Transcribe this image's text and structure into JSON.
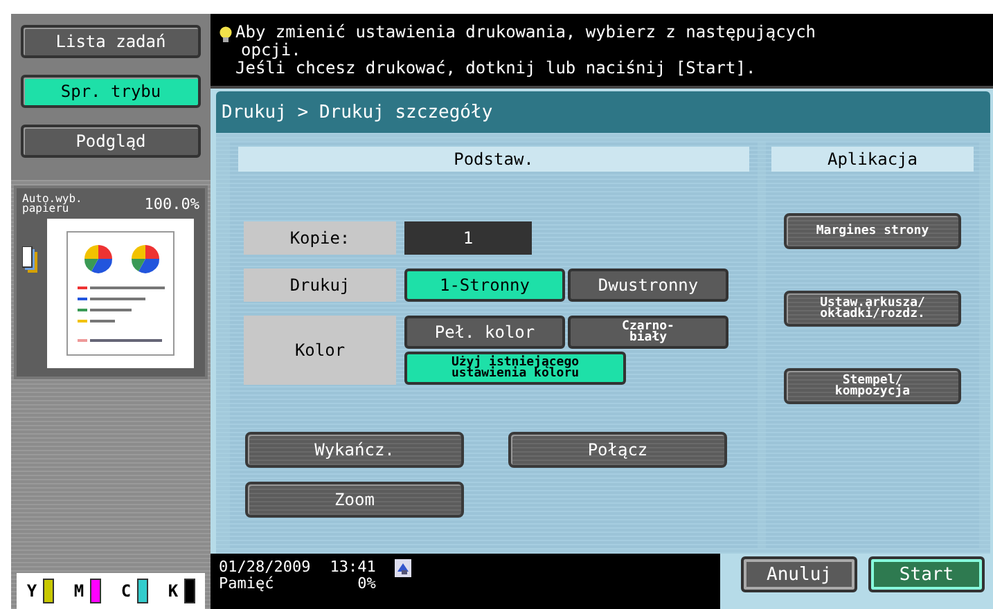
{
  "sidebar": {
    "buttons": [
      {
        "label": "Lista zadań",
        "selected": false
      },
      {
        "label": "Spr. trybu",
        "selected": true
      },
      {
        "label": "Podgląd",
        "selected": false
      }
    ],
    "preview": {
      "paper": "Auto.wyb.\npapieru",
      "zoom": "100.0%"
    },
    "toner": [
      {
        "label": "Y",
        "color": "#c8c800"
      },
      {
        "label": "M",
        "color": "#ff00ff"
      },
      {
        "label": "C",
        "color": "#33cccc"
      },
      {
        "label": "K",
        "color": "#000000"
      }
    ]
  },
  "message": {
    "lines": [
      "Aby zmienić ustawienia drukowania, wybierz z następujących",
      "opcji.",
      "Jeśli chcesz drukować, dotknij lub naciśnij [Start]."
    ]
  },
  "breadcrumb": "Drukuj > Drukuj szczegóły",
  "basic": {
    "title": "Podstaw.",
    "copies": {
      "label": "Kopie:",
      "value": "1"
    },
    "settings": [
      {
        "label": "Drukuj",
        "options": [
          {
            "label": "1-Stronny",
            "selected": true
          },
          {
            "label": "Dwustronny",
            "selected": false
          }
        ]
      },
      {
        "label": "Kolor",
        "options": [
          {
            "label": "Peł. kolor",
            "selected": false
          },
          {
            "label": "Czarno-\nbiały",
            "selected": false
          },
          {
            "label": "Użyj istniejącego\nustawienia koloru",
            "selected": true
          }
        ]
      }
    ],
    "buttons": [
      "Wykańcz.",
      "Połącz",
      "Zoom"
    ]
  },
  "applications": {
    "title": "Aplikacja",
    "buttons": [
      "Margines strony",
      "Ustaw.arkusza/\nokładki/rozdz.",
      "Stempel/\nkompozycja"
    ]
  },
  "status": {
    "date": "01/28/2009",
    "time": "13:41",
    "memory_label": "Pamięć",
    "memory": "0%"
  },
  "actions": [
    {
      "label": "Anuluj",
      "kind": "cancel"
    },
    {
      "label": "Start",
      "kind": "start"
    }
  ]
}
